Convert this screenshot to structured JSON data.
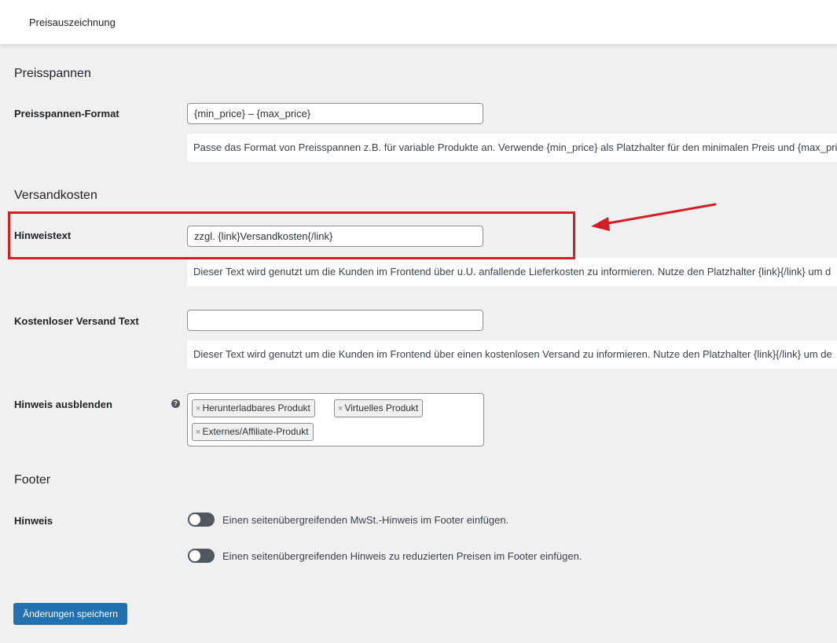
{
  "header": {
    "title": "Preisauszeichnung"
  },
  "sections": {
    "price_ranges": {
      "title": "Preisspannen",
      "format_label": "Preisspannen-Format",
      "format_value": "{min_price} – {max_price}",
      "format_desc": "Passe das Format von Preisspannen z.B. für variable Produkte an. Verwende {min_price} als Platzhalter für den minimalen Preis und {max_price"
    },
    "shipping": {
      "title": "Versandkosten",
      "notice_label": "Hinweistext",
      "notice_value": "zzgl. {link}Versandkosten{/link}",
      "notice_desc": "Dieser Text wird genutzt um die Kunden im Frontend über u.U. anfallende Lieferkosten zu informieren. Nutze den Platzhalter {link}{/link} um d",
      "free_label": "Kostenloser Versand Text",
      "free_value": "",
      "free_desc": "Dieser Text wird genutzt um die Kunden im Frontend über einen kostenlosen Versand zu informieren. Nutze den Platzhalter {link}{/link} um de",
      "hide_label": "Hinweis ausblenden",
      "hide_tags": [
        "Herunterladbares Produkt",
        "Virtuelles Produkt",
        "Externes/Affiliate-Produkt"
      ]
    },
    "footer": {
      "title": "Footer",
      "notice_label": "Hinweis",
      "toggle1_label": "Einen seitenübergreifenden MwSt.-Hinweis im Footer einfügen.",
      "toggle1_on": false,
      "toggle2_label": "Einen seitenübergreifenden Hinweis zu reduzierten Preisen im Footer einfügen.",
      "toggle2_on": false
    }
  },
  "icons": {
    "tag_remove": "×",
    "help": "?"
  },
  "actions": {
    "save_label": "Änderungen speichern"
  },
  "colors": {
    "primary": "#2271b1",
    "highlight": "#d21f26",
    "toggle_off": "#50575e"
  }
}
